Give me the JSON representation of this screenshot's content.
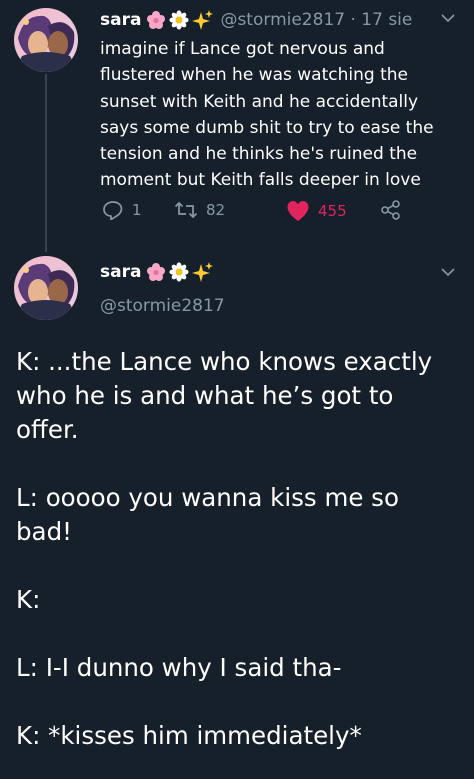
{
  "tweet1": {
    "name": "sara",
    "emojis": [
      "cherry-blossom-emoji",
      "daisy-emoji",
      "sparkles-emoji"
    ],
    "handle_time": "@stormie2817 · 17 sie",
    "lines": [
      "imagine if Lance got nervous and",
      "flustered when he was watching the",
      "sunset with Keith and he accidentally",
      "says some dumb shit to try to ease the",
      "tension and he thinks he's ruined the",
      "moment but Keith falls deeper in love"
    ],
    "reply_count": "1",
    "retweet_count": "82",
    "like_count": "455",
    "colors": {
      "like": "#e0245e",
      "muted": "#8899a6",
      "background": "#15202b"
    }
  },
  "tweet2": {
    "name": "sara",
    "emojis": [
      "cherry-blossom-emoji",
      "daisy-emoji",
      "sparkles-emoji"
    ],
    "handle": "@stormie2817",
    "paragraphs": [
      "K: ...the Lance who knows exactly\nwho he is and what he’s got to\noffer.",
      "L: ooooo you wanna kiss me so\nbad!",
      "K:",
      "L: I-I dunno why I said tha-",
      "K: *kisses him immediately*"
    ]
  }
}
